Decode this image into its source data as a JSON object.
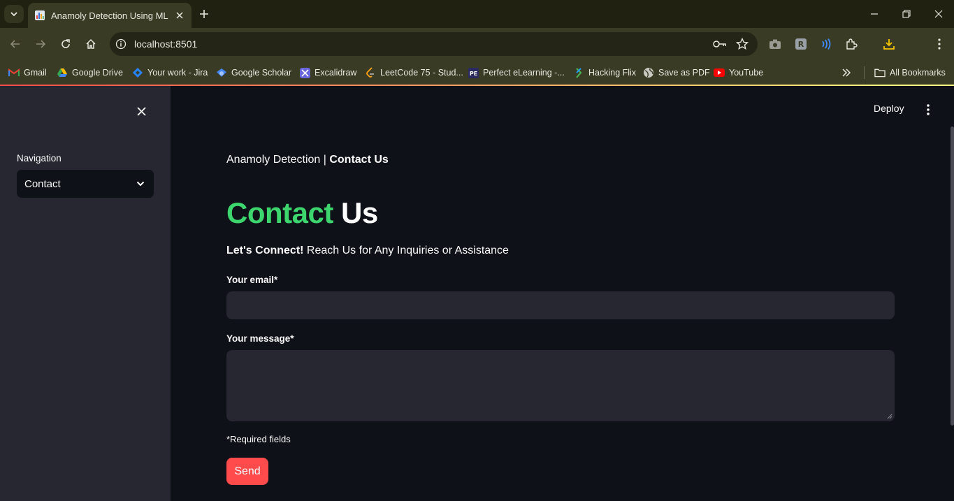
{
  "browser": {
    "tab_title": "Anamoly Detection Using ML",
    "url": "localhost:8501",
    "bookmarks": [
      {
        "label": "Gmail",
        "icon": "gmail-icon"
      },
      {
        "label": "Google Drive",
        "icon": "google-drive-icon"
      },
      {
        "label": "Your work - Jira",
        "icon": "jira-icon"
      },
      {
        "label": "Google Scholar",
        "icon": "google-scholar-icon"
      },
      {
        "label": "Excalidraw",
        "icon": "excalidraw-icon"
      },
      {
        "label": "LeetCode 75 - Stud...",
        "icon": "leetcode-icon"
      },
      {
        "label": "Perfect eLearning -...",
        "icon": "pe-icon"
      },
      {
        "label": "Hacking Flix",
        "icon": "hacking-flix-icon"
      },
      {
        "label": "Save as PDF",
        "icon": "globe-icon"
      },
      {
        "label": "YouTube",
        "icon": "youtube-icon"
      }
    ],
    "all_bookmarks": "All Bookmarks"
  },
  "app": {
    "sidebar": {
      "nav_label": "Navigation",
      "nav_selected": "Contact"
    },
    "header": {
      "deploy": "Deploy"
    },
    "breadcrumb": {
      "prefix": "Anamoly Detection | ",
      "current": "Contact Us"
    },
    "title": {
      "part1": "Contact",
      "part2": "Us"
    },
    "subtitle": {
      "bold": "Let's Connect!",
      "rest": " Reach Us for Any Inquiries or Assistance"
    },
    "form": {
      "email_label": "Your email*",
      "email_value": "",
      "message_label": "Your message*",
      "message_value": "",
      "required_note": "*Required fields",
      "send_label": "Send"
    }
  },
  "colors": {
    "accent_green": "#3dd56d",
    "send_button": "#ff4b4b",
    "background": "#0e1117",
    "sidebar": "#262730"
  }
}
